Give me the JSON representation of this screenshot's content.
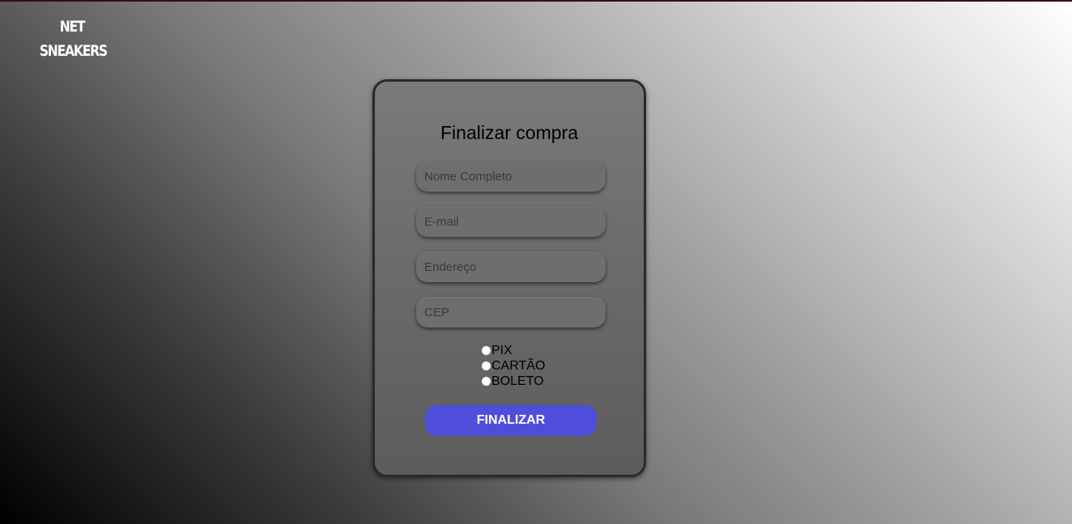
{
  "brand": {
    "line1": "NET",
    "line2": "SNEAKERS"
  },
  "form": {
    "title": "Finalizar compra",
    "fields": [
      {
        "placeholder": "Nome Completo",
        "value": ""
      },
      {
        "placeholder": "E-mail",
        "value": ""
      },
      {
        "placeholder": "Endereço",
        "value": ""
      },
      {
        "placeholder": "CEP",
        "value": ""
      }
    ],
    "payment_options": [
      {
        "label": "PIX"
      },
      {
        "label": "CARTÃO"
      },
      {
        "label": "BOLETO"
      }
    ],
    "submit_label": "FINALIZAR"
  },
  "colors": {
    "accent": "#4f4edb",
    "card_border": "#2a2a2a"
  }
}
